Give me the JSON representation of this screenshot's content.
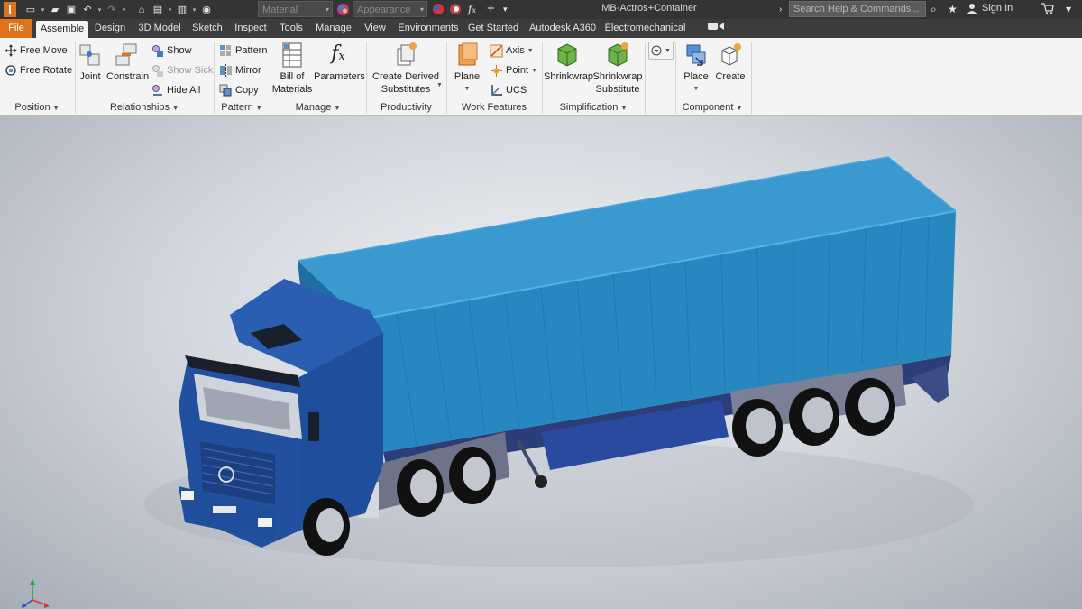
{
  "app": {
    "logo_letter": "I",
    "document_title": "MB-Actros+Container",
    "material_select": "Material",
    "appearance_select": "Appearance",
    "search_placeholder": "Search Help & Commands...",
    "sign_in": "Sign In"
  },
  "tabs": [
    {
      "label": "File"
    },
    {
      "label": "Assemble"
    },
    {
      "label": "Design"
    },
    {
      "label": "3D Model"
    },
    {
      "label": "Sketch"
    },
    {
      "label": "Inspect"
    },
    {
      "label": "Tools"
    },
    {
      "label": "Manage"
    },
    {
      "label": "View"
    },
    {
      "label": "Environments"
    },
    {
      "label": "Get Started"
    },
    {
      "label": "Autodesk A360"
    },
    {
      "label": "Electromechanical"
    }
  ],
  "ribbon": {
    "position": {
      "free_move": "Free Move",
      "free_rotate": "Free Rotate",
      "label": "Position"
    },
    "relationships": {
      "joint": "Joint",
      "constrain": "Constrain",
      "show": "Show",
      "show_sick": "Show Sick",
      "hide_all": "Hide All",
      "label": "Relationships"
    },
    "pattern": {
      "pattern": "Pattern",
      "mirror": "Mirror",
      "copy": "Copy",
      "label": "Pattern"
    },
    "manage": {
      "bom_line1": "Bill of",
      "bom_line2": "Materials",
      "parameters": "Parameters",
      "label": "Manage"
    },
    "productivity": {
      "derived_line1": "Create Derived",
      "derived_line2": "Substitutes",
      "label": "Productivity"
    },
    "work_features": {
      "plane": "Plane",
      "axis": "Axis",
      "point": "Point",
      "ucs": "UCS",
      "label": "Work Features"
    },
    "simplification": {
      "shrinkwrap": "Shrinkwrap",
      "shrinkwrap_sub_line1": "Shrinkwrap",
      "shrinkwrap_sub_line2": "Substitute",
      "label": "Simplification"
    },
    "component": {
      "place": "Place",
      "create": "Create",
      "label": "Component"
    }
  },
  "colors": {
    "accent_orange": "#e0721a",
    "titlebar": "#343434",
    "ribbon_bg": "#f4f4f4",
    "cab_blue": "#1f4f9a",
    "container_blue": "#2a8ac0"
  },
  "icons": [
    "app-logo-icon",
    "new-icon",
    "open-icon",
    "save-icon",
    "undo-icon",
    "redo-icon",
    "home-icon",
    "print-icon",
    "update-icon",
    "measure-icon",
    "appearance-icon",
    "fx-icon",
    "plus-icon",
    "search-icon",
    "star-icon",
    "user-icon",
    "cart-icon"
  ]
}
